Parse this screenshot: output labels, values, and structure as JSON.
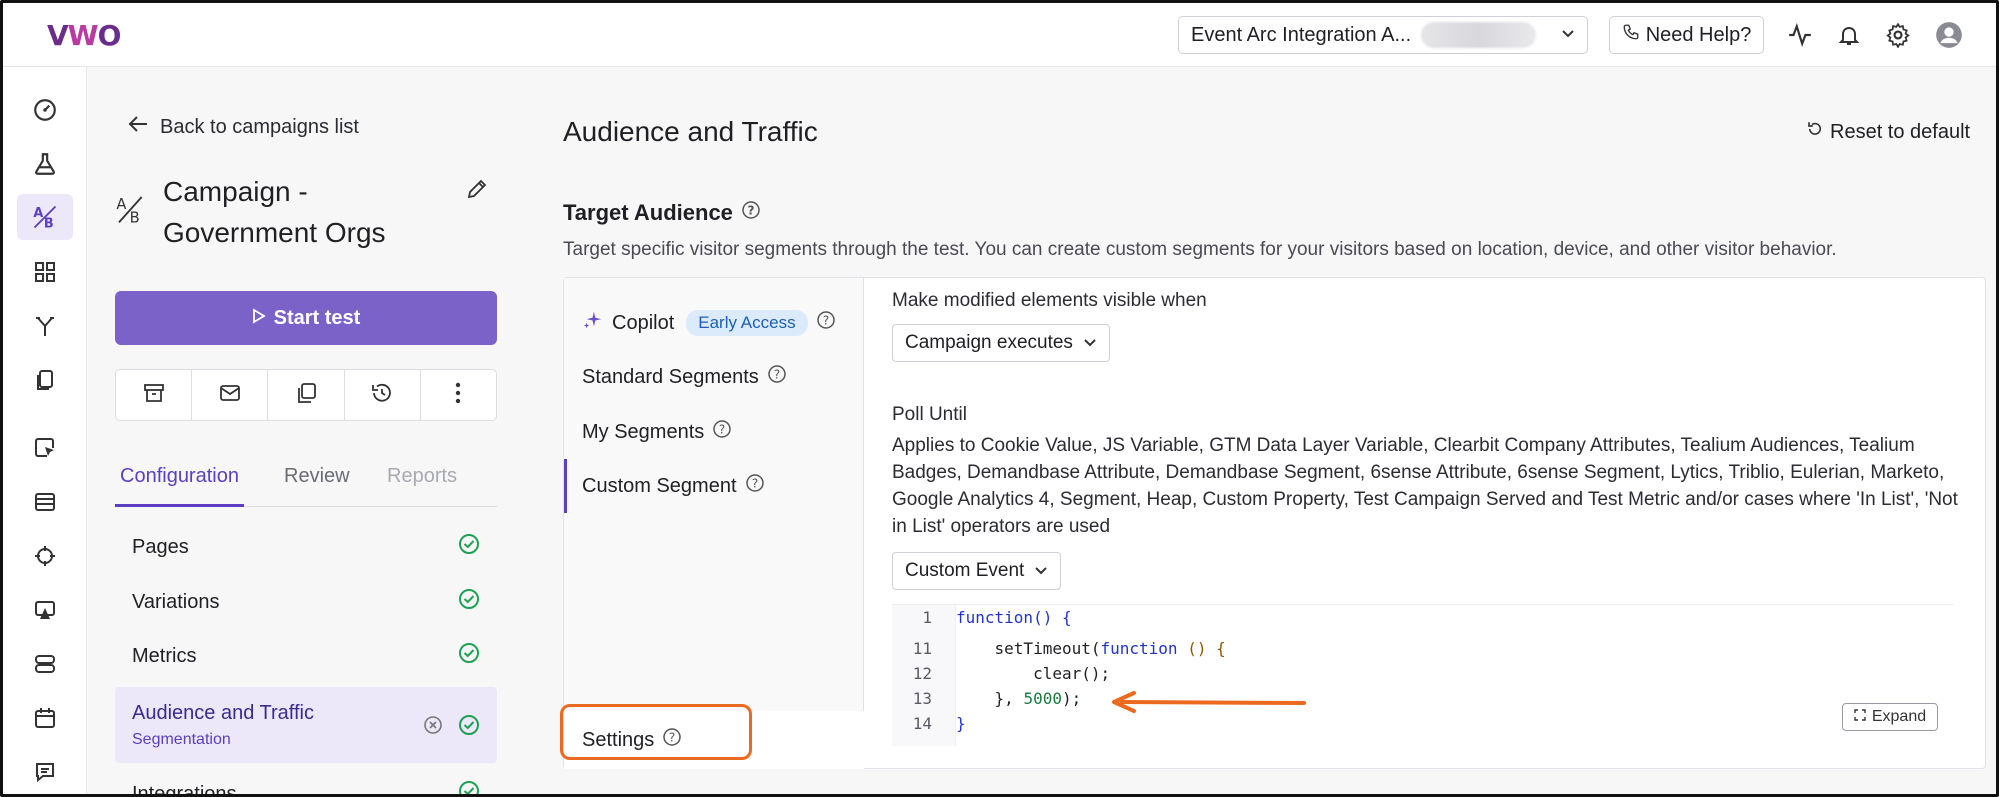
{
  "topbar": {
    "logo": "VWO",
    "account_name": "Event Arc Integration A...",
    "help_label": "Need Help?"
  },
  "left_panel": {
    "back_label": "Back to campaigns list",
    "campaign_title": "Campaign - Government Orgs",
    "start_label": "Start test",
    "tabs": [
      "Configuration",
      "Review",
      "Reports"
    ],
    "nav": [
      {
        "label": "Pages",
        "sub": ""
      },
      {
        "label": "Variations",
        "sub": ""
      },
      {
        "label": "Metrics",
        "sub": ""
      },
      {
        "label": "Audience and Traffic",
        "sub": "Segmentation"
      },
      {
        "label": "Integrations",
        "sub": ""
      }
    ]
  },
  "main": {
    "title": "Audience and Traffic",
    "reset_label": "Reset to default",
    "section_title": "Target Audience",
    "section_desc": "Target specific visitor segments through the test. You can create custom segments for your visitors based on location, device, and other visitor behavior.",
    "segments": {
      "copilot": "Copilot",
      "early_access": "Early Access",
      "standard": "Standard Segments",
      "mine": "My Segments",
      "custom": "Custom Segment",
      "settings": "Settings"
    },
    "visible_when_label": "Make modified elements visible when",
    "visible_when_value": "Campaign executes",
    "poll_label": "Poll Until",
    "poll_desc": "Applies to Cookie Value, JS Variable, GTM Data Layer Variable, Clearbit Company Attributes, Tealium Audiences, Tealium Badges, Demandbase Attribute, Demandbase Segment, 6sense Attribute, 6sense Segment, Lytics, Triblio, Eulerian, Marketo, Google Analytics 4, Segment, Heap, Custom Property, Test Campaign Served and Test Metric and/or cases where 'In List', 'Not in List' operators are used",
    "poll_value": "Custom Event",
    "code": {
      "line_numbers": [
        "1",
        "11",
        "12",
        "13",
        "14"
      ],
      "line1_kw": "function",
      "line1_rest": "() {",
      "line11_a": "    setTimeout(",
      "line11_kw": "function",
      "line11_b": " () {",
      "line12": "        clear();",
      "line13_a": "    }, ",
      "line13_num": "5000",
      "line13_b": ");",
      "line14": "}"
    },
    "expand_label": "Expand"
  },
  "colors": {
    "accent": "#5b3fc0",
    "start_button": "#7a62c9",
    "highlight": "#ec6a1f",
    "success": "#1fa055"
  }
}
